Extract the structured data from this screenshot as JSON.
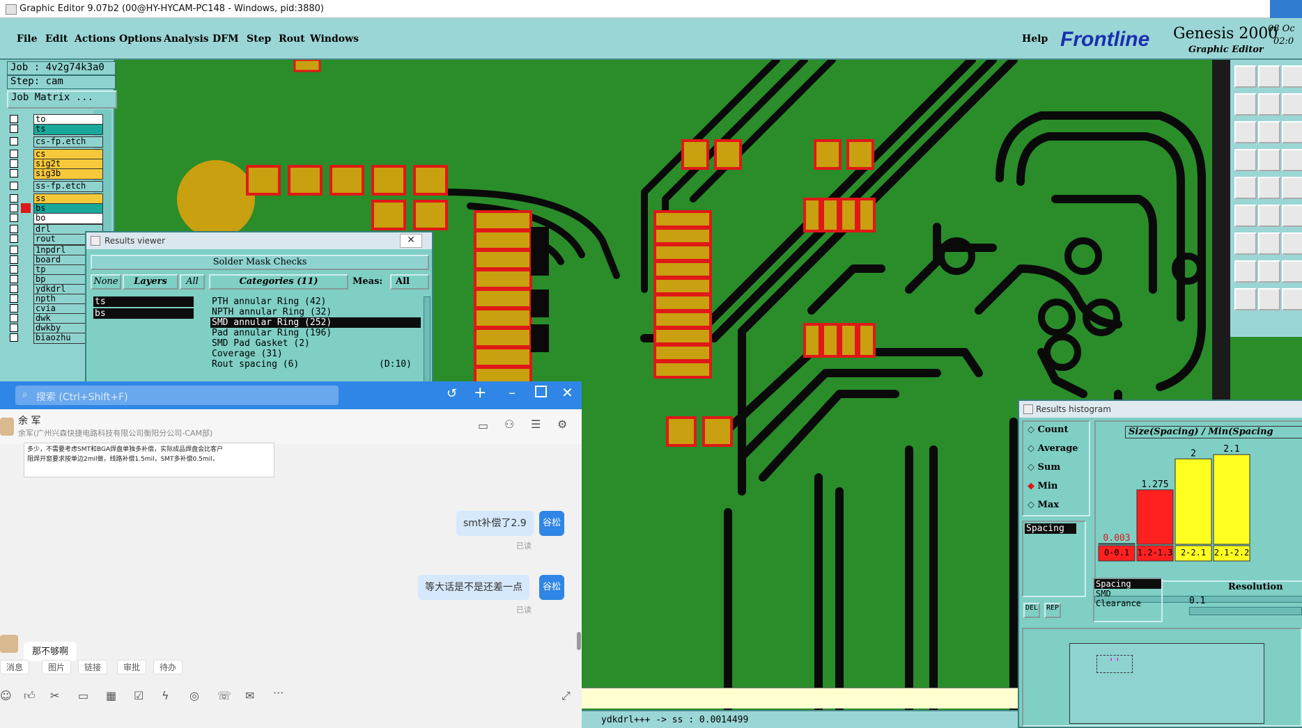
{
  "window": {
    "title": "Graphic Editor 9.07b2 (00@HY-HYCAM-PC148 - Windows, pid:3880)"
  },
  "menubar": {
    "items": [
      "File",
      "Edit",
      "Actions",
      "Options",
      "Analysis",
      "DFM",
      "Step",
      "Rout",
      "Windows"
    ],
    "help": "Help",
    "brand": "Frontline",
    "product": "Genesis 2000",
    "subtitle": "Graphic Editor",
    "date_fragment": "08 Oc",
    "time_fragment": "02:0"
  },
  "job": {
    "job_label": "Job : 4v2g74k3a0",
    "step_label": "Step: cam",
    "matrix_button": "Job Matrix ..."
  },
  "layers": [
    {
      "name": "to",
      "color": "#ffffff"
    },
    {
      "name": "ts",
      "color": "#1aa89a"
    },
    {
      "name": "cs-fp.etch",
      "color": "#8fd3cf"
    },
    {
      "name": "cs",
      "color": "#f7c93a"
    },
    {
      "name": "sig2t",
      "color": "#f7c93a"
    },
    {
      "name": "sig3b",
      "color": "#f7c93a"
    },
    {
      "name": "ss-fp.etch",
      "color": "#8fd3cf"
    },
    {
      "name": "ss",
      "color": "#f7c93a"
    },
    {
      "name": "bs",
      "color": "#1aa89a"
    },
    {
      "name": "bo",
      "color": "#ffffff"
    },
    {
      "name": "drl",
      "color": "#8fd3cf"
    },
    {
      "name": "rout",
      "color": "#8fd3cf"
    },
    {
      "name": "1npdrl",
      "color": "#8fd3cf"
    },
    {
      "name": "board",
      "color": "#8fd3cf"
    },
    {
      "name": "tp",
      "color": "#8fd3cf"
    },
    {
      "name": "bp",
      "color": "#8fd3cf"
    },
    {
      "name": "ydkdrl",
      "color": "#8fd3cf"
    },
    {
      "name": "npth",
      "color": "#8fd3cf"
    },
    {
      "name": "cvia",
      "color": "#8fd3cf"
    },
    {
      "name": "dwk",
      "color": "#8fd3cf"
    },
    {
      "name": "dwkby",
      "color": "#8fd3cf"
    },
    {
      "name": "biaozhu",
      "color": "#8fd3cf"
    }
  ],
  "results_viewer": {
    "title": "Results viewer",
    "header": "Solder Mask Checks",
    "btn_none": "None",
    "btn_layers": "Layers",
    "btn_all": "All",
    "btn_categories": "Categories (11)",
    "meas_label": "Meas:",
    "meas_value": "All",
    "layer_list": [
      "ts",
      "bs"
    ],
    "categories": [
      "PTH annular Ring (42)",
      "NPTH annular Ring (32)",
      "SMD annular Ring (252)",
      "Pad annular Ring (196)",
      "SMD Pad Gasket (2)",
      "Coverage (31)",
      "Rout spacing (6)"
    ],
    "category_suffix": "(D:10)",
    "selected_index": 2
  },
  "chat": {
    "search_placeholder": "搜索 (Ctrl+Shift+F)",
    "contact_name": "余 军",
    "contact_org": "余军(广州兴森快捷电路科技有限公司衡阳分公司-CAM部)",
    "image_text_line1": "多少，不需要考虑SMT和BGA焊盘单独多补偿，实际成品焊盘会比客户",
    "image_text_line2": "阻焊开窗要求按单边2mil做，线路补偿1.5mil，SMT多补偿0.5mil，",
    "messages": [
      {
        "text": "smt补偿了2.9",
        "sender": "谷松",
        "status": "已读"
      },
      {
        "text": "等大话是不是还差一点",
        "sender": "谷松",
        "status": "已读"
      }
    ],
    "incoming": "那不够啊",
    "quick_tabs": [
      "消息",
      "图片",
      "链接",
      "审批",
      "待办"
    ]
  },
  "histogram": {
    "title": "Results histogram",
    "options": [
      "Count",
      "Average",
      "Sum",
      "Min",
      "Max"
    ],
    "selected_option": "Min",
    "list_selected": "Spacing",
    "btn_del": "DEL",
    "btn_rep": "REP",
    "chart_title": "Size(Spacing) / Min(Spacing",
    "sublist": [
      "Spacing",
      "SMD",
      "Clearance"
    ],
    "resolution_label": "Resolution",
    "resolution_value": "0.1"
  },
  "chart_data": {
    "type": "bar",
    "title": "Size(Spacing) / Min(Spacing",
    "categories": [
      "0-0.1",
      "1.2-1.3",
      "2-2.1",
      "2.1-2.2"
    ],
    "values": [
      0.003,
      1.275,
      2,
      2.1
    ],
    "value_labels": [
      "0.003",
      "1.275",
      "2",
      "2.1"
    ],
    "bar_colors": [
      "#ff2020",
      "#ff2020",
      "#ffff20",
      "#ffff20"
    ],
    "ylim": [
      0,
      2.25
    ],
    "grid": false
  },
  "status": {
    "text": "ydkdrl+++ -> ss : 0.0014499"
  },
  "colors": {
    "board": "#2a8d2a",
    "trace": "#0a0a0a",
    "pad": "#c8a010",
    "pad_outline": "#e01818",
    "panel": "#8fd3cf",
    "chat_blue": "#2f86e6"
  }
}
